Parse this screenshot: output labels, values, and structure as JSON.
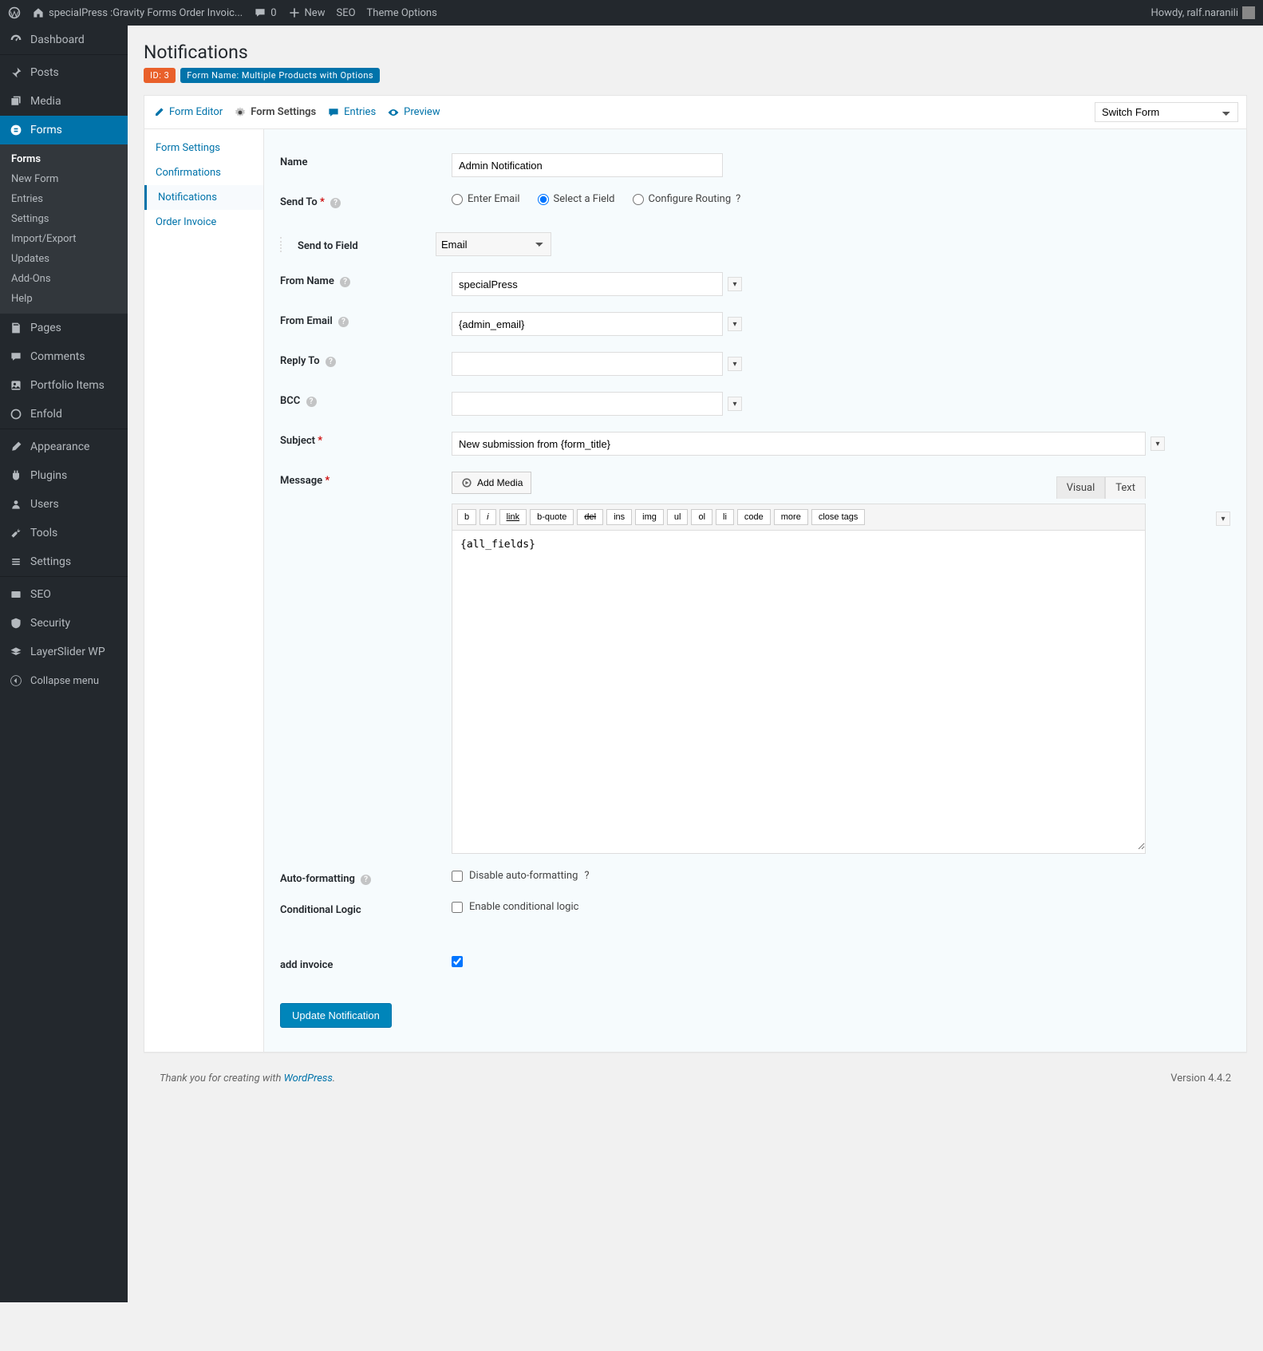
{
  "toolbar": {
    "site_name": "specialPress :Gravity Forms Order Invoic...",
    "comments_count": "0",
    "new_label": "New",
    "seo_label": "SEO",
    "theme_options_label": "Theme Options",
    "howdy": "Howdy, ralf.naranili"
  },
  "admin_menu": {
    "dashboard": "Dashboard",
    "posts": "Posts",
    "media": "Media",
    "forms": "Forms",
    "pages": "Pages",
    "comments": "Comments",
    "portfolio_items": "Portfolio Items",
    "enfold": "Enfold",
    "appearance": "Appearance",
    "plugins": "Plugins",
    "users": "Users",
    "tools": "Tools",
    "settings": "Settings",
    "seo": "SEO",
    "security": "Security",
    "layerslider": "LayerSlider WP",
    "collapse": "Collapse menu"
  },
  "forms_submenu": {
    "items": [
      "Forms",
      "New Form",
      "Entries",
      "Settings",
      "Import/Export",
      "Updates",
      "Add-Ons",
      "Help"
    ],
    "current_index": 0
  },
  "page": {
    "title": "Notifications",
    "id_badge": "ID: 3",
    "name_badge": "Form Name: Multiple Products with Options"
  },
  "form_toolbar": {
    "editor": "Form Editor",
    "settings": "Form Settings",
    "entries": "Entries",
    "preview": "Preview",
    "switch_form": "Switch Form"
  },
  "side_tabs": [
    "Form Settings",
    "Confirmations",
    "Notifications",
    "Order Invoice"
  ],
  "side_tabs_active_index": 2,
  "fields": {
    "name": {
      "label": "Name",
      "value": "Admin Notification"
    },
    "send_to": {
      "label": "Send To",
      "options": [
        "Enter Email",
        "Select a Field",
        "Configure Routing"
      ],
      "selected_index": 1,
      "field_label": "Send to Field",
      "field_value": "Email"
    },
    "from_name": {
      "label": "From Name",
      "value": "specialPress"
    },
    "from_email": {
      "label": "From Email",
      "value": "{admin_email}"
    },
    "reply_to": {
      "label": "Reply To",
      "value": ""
    },
    "bcc": {
      "label": "BCC",
      "value": ""
    },
    "subject": {
      "label": "Subject",
      "value": "New submission from {form_title}"
    },
    "message": {
      "label": "Message",
      "add_media": "Add Media",
      "tabs": {
        "visual": "Visual",
        "text": "Text"
      },
      "quicktags": [
        "b",
        "i",
        "link",
        "b-quote",
        "del",
        "ins",
        "img",
        "ul",
        "ol",
        "li",
        "code",
        "more",
        "close tags"
      ],
      "body": "{all_fields}"
    },
    "auto_formatting": {
      "label": "Auto-formatting",
      "checkbox_label": "Disable auto-formatting"
    },
    "conditional_logic": {
      "label": "Conditional Logic",
      "checkbox_label": "Enable conditional logic"
    },
    "add_invoice": {
      "label": "add invoice"
    }
  },
  "submit_label": "Update Notification",
  "footer": {
    "thanks_prefix": "Thank you for creating with ",
    "wordpress": "WordPress",
    "dot": ".",
    "version": "Version 4.4.2"
  }
}
